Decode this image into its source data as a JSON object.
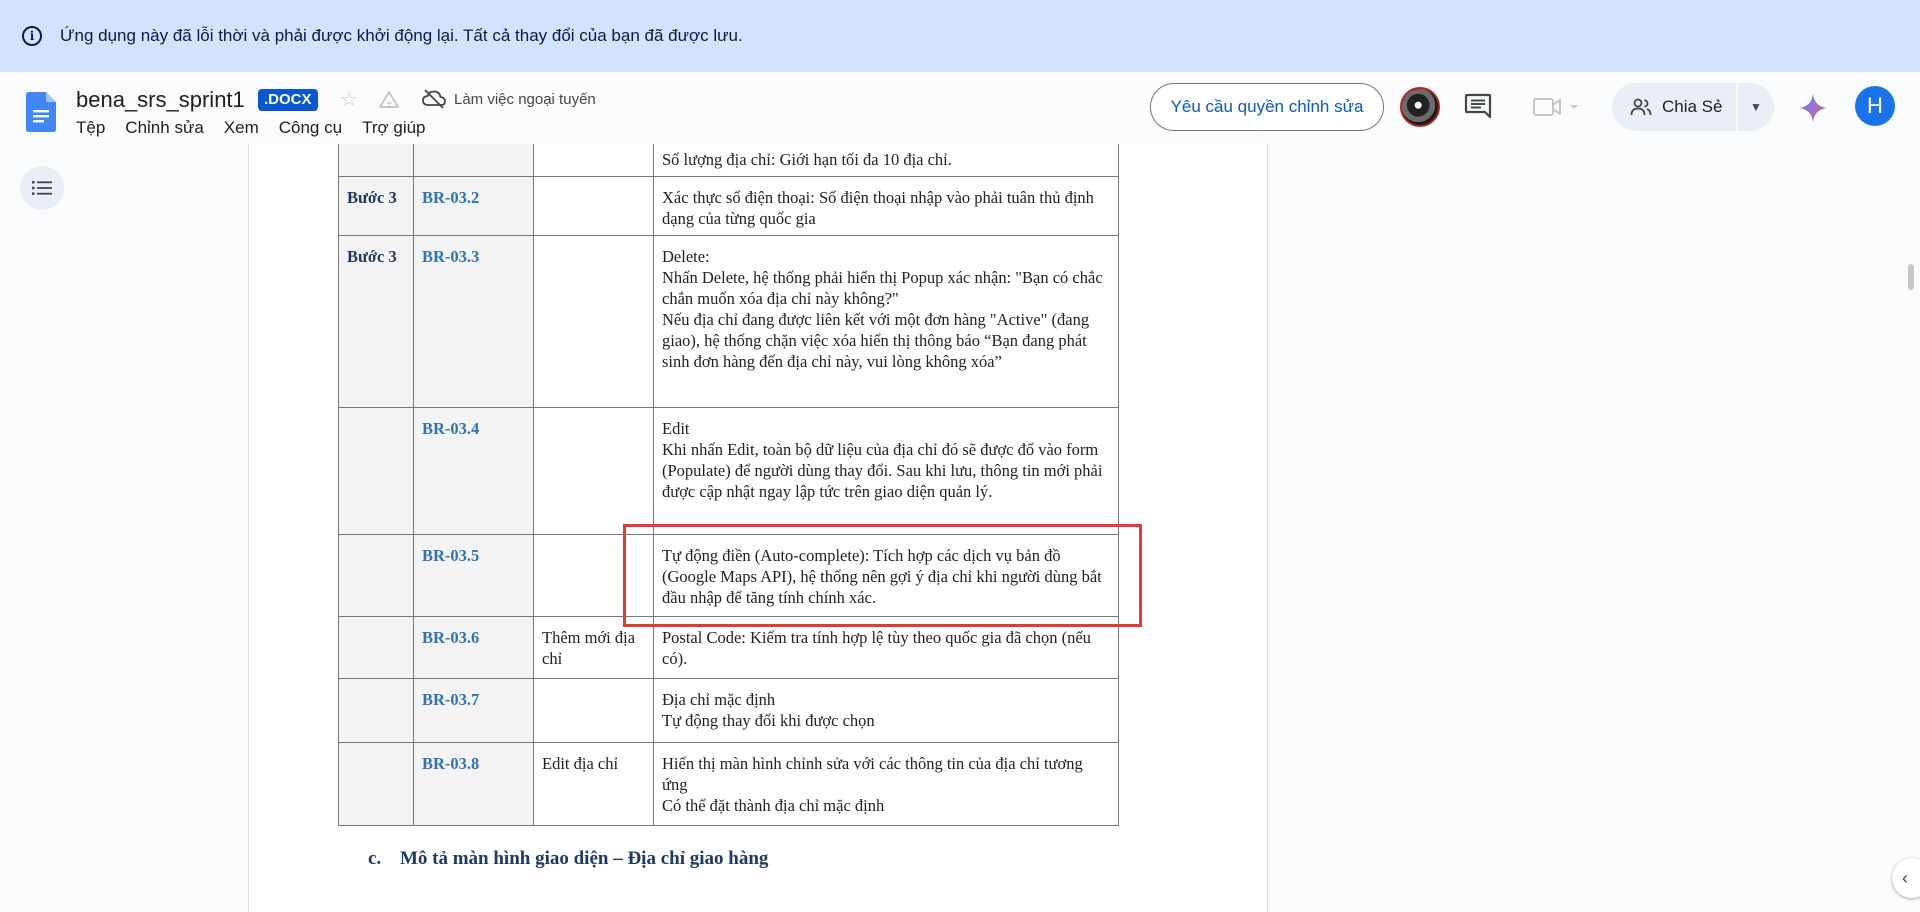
{
  "banner": {
    "message": "Ứng dụng này đã lỗi thời và phải được khởi động lại. Tất cả thay đổi của bạn đã được lưu."
  },
  "header": {
    "title": "bena_srs_sprint1",
    "badge": ".DOCX",
    "offline_label": "Làm việc ngoại tuyến",
    "menu": [
      "Tệp",
      "Chỉnh sửa",
      "Xem",
      "Công cụ",
      "Trợ giúp"
    ],
    "request_edit_label": "Yêu cầu quyền chỉnh sửa",
    "share_label": "Chia Sẻ",
    "user_initial": "H"
  },
  "colors": {
    "banner_bg": "#d3e3fd",
    "accent": "#0b57d0",
    "highlight_border": "#e03a3a"
  },
  "icons": [
    "info-icon",
    "docs-logo-icon",
    "star-icon",
    "drive-move-icon",
    "cloud-off-icon",
    "comment-icon",
    "meet-icon",
    "people-icon",
    "chevron-down-icon",
    "gemini-icon",
    "outline-icon",
    "chevron-left-icon"
  ],
  "table": {
    "rows": [
      {
        "step": "",
        "code": "",
        "name": "",
        "desc": [
          "Số lượng địa chỉ: Giới hạn tối đa 10 địa chỉ."
        ]
      },
      {
        "step": "Bước 3",
        "code": "BR-03.2",
        "name": "",
        "desc": [
          "Xác thực số điện thoại: Số điện thoại nhập vào phải tuân thủ định dạng của từng quốc gia"
        ]
      },
      {
        "step": "Bước 3",
        "code": "BR-03.3",
        "name": "",
        "desc": [
          "Delete:",
          "Nhấn Delete, hệ thống phải hiển thị Popup xác nhận: \"Bạn có chắc chắn muốn xóa địa chỉ này không?\"",
          "Nếu địa chỉ đang được liên kết với một đơn hàng \"Active\" (đang giao), hệ thống chặn việc xóa hiển thị thông báo “Bạn đang phát sinh đơn hàng đến địa chỉ này, vui lòng không xóa”"
        ]
      },
      {
        "step": "",
        "code": "BR-03.4",
        "name": "",
        "desc": [
          "Edit",
          "Khi nhấn Edit, toàn bộ dữ liệu của địa chỉ đó sẽ được đổ vào form (Populate) để người dùng thay đổi. Sau khi lưu, thông tin mới phải được cập nhật ngay lập tức trên giao diện quản lý."
        ]
      },
      {
        "step": "",
        "code": "BR-03.5",
        "name": "",
        "desc": [
          "Tự động điền (Auto-complete): Tích hợp các dịch vụ bản đồ (Google Maps API), hệ thống nên gợi ý địa chỉ khi người dùng bắt đầu nhập để tăng tính chính xác."
        ]
      },
      {
        "step": "",
        "code": "BR-03.6",
        "name": "Thêm mới địa chỉ",
        "desc": [
          "Postal Code: Kiểm tra tính hợp lệ tùy theo quốc gia đã chọn (nếu có)."
        ]
      },
      {
        "step": "",
        "code": "BR-03.7",
        "name": "",
        "desc": [
          "Địa chỉ mặc định",
          "Tự động thay đổi khi được chọn"
        ]
      },
      {
        "step": "",
        "code": "BR-03.8",
        "name": "Edit địa chỉ",
        "desc": [
          "Hiển thị màn hình chỉnh sửa với các thông tin của địa chỉ tương ứng",
          "Có thể đặt thành địa chỉ mặc định"
        ]
      }
    ]
  },
  "section": {
    "number": "c.",
    "title": "Mô tả màn hình giao diện – Địa chỉ giao hàng"
  }
}
